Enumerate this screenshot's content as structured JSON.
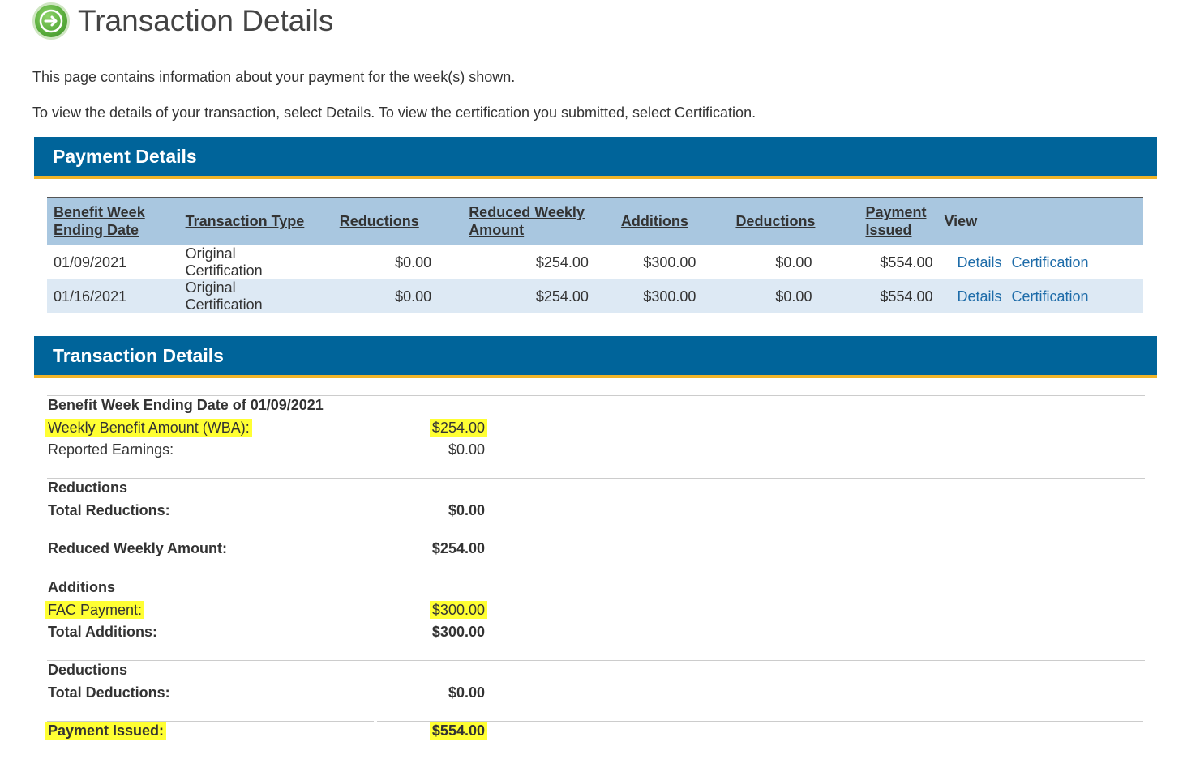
{
  "page_title": "Transaction Details",
  "intro": {
    "line1": "This page contains information about your payment for the week(s) shown.",
    "line2": "To view the details of your transaction, select Details. To view the certification you submitted, select Certification."
  },
  "payment_section": {
    "heading": "Payment Details",
    "columns": {
      "benefit_week": "Benefit Week Ending Date",
      "transaction_type": "Transaction Type",
      "reductions": "Reductions",
      "reduced_weekly": "Reduced Weekly Amount",
      "additions": "Additions",
      "deductions": "Deductions",
      "payment_issued": "Payment Issued",
      "view": "View"
    },
    "rows": [
      {
        "date": "01/09/2021",
        "type": "Original Certification",
        "reductions": "$0.00",
        "reduced_weekly": "$254.00",
        "additions": "$300.00",
        "deductions": "$0.00",
        "payment_issued": "$554.00",
        "details_link": "Details",
        "cert_link": "Certification"
      },
      {
        "date": "01/16/2021",
        "type": "Original Certification",
        "reductions": "$0.00",
        "reduced_weekly": "$254.00",
        "additions": "$300.00",
        "deductions": "$0.00",
        "payment_issued": "$554.00",
        "details_link": "Details",
        "cert_link": "Certification"
      }
    ]
  },
  "transaction_section": {
    "heading": "Transaction Details",
    "week_heading": "Benefit Week Ending Date of 01/09/2021",
    "wba_label": "Weekly Benefit Amount (WBA):",
    "wba_value": "$254.00",
    "earnings_label": "Reported Earnings:",
    "earnings_value": "$0.00",
    "reductions_heading": "Reductions",
    "total_reductions_label": "Total Reductions:",
    "total_reductions_value": "$0.00",
    "reduced_weekly_label": "Reduced Weekly Amount:",
    "reduced_weekly_value": "$254.00",
    "additions_heading": "Additions",
    "fac_label": "FAC Payment:",
    "fac_value": "$300.00",
    "total_additions_label": "Total Additions:",
    "total_additions_value": "$300.00",
    "deductions_heading": "Deductions",
    "total_deductions_label": "Total Deductions:",
    "total_deductions_value": "$0.00",
    "payment_issued_label": "Payment Issued:",
    "payment_issued_value": "$554.00"
  },
  "colors": {
    "section_bar": "#00649a",
    "section_bar_accent": "#f0b429",
    "table_header": "#a9c7e0",
    "alt_row": "#dde9f4",
    "link": "#1e6ca9",
    "highlight": "#ffff33"
  }
}
